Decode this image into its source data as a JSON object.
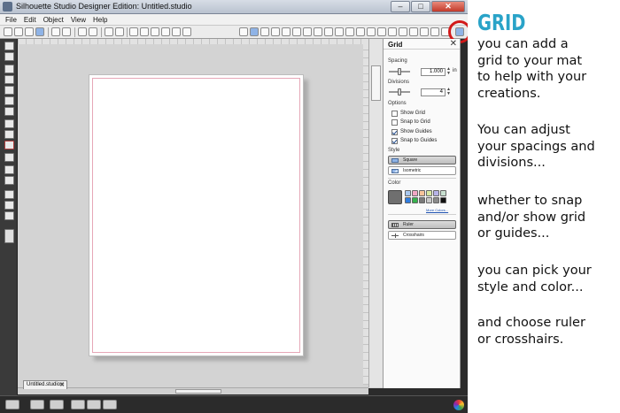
{
  "window": {
    "title": "Silhouette Studio Designer Edition: Untitled.studio",
    "min": "–",
    "max": "□",
    "close": "✕"
  },
  "menu": [
    "File",
    "Edit",
    "Object",
    "View",
    "Help"
  ],
  "document_tab": {
    "label": "Untitled.studio",
    "close": "✖"
  },
  "grid_panel": {
    "title": "Grid",
    "close": "✕",
    "spacing_label": "Spacing",
    "spacing_value": "1.000",
    "spacing_unit": "in",
    "spacing_slider_fraction": 0.5,
    "divisions_label": "Divisions",
    "divisions_value": "4",
    "divisions_slider_fraction": 0.5,
    "spin_up": "▲",
    "spin_down": "▼",
    "options_label": "Options",
    "options": [
      {
        "label": "Show Grid",
        "checked": false
      },
      {
        "label": "Snap to Grid",
        "checked": false
      },
      {
        "label": "Show Guides",
        "checked": true
      },
      {
        "label": "Snap to Guides",
        "checked": true
      }
    ],
    "style_label": "Style",
    "styles": [
      {
        "label": "Square",
        "selected": true
      },
      {
        "label": "Isometric",
        "selected": false
      }
    ],
    "color_label": "Color",
    "current_color": "#6f6f6f",
    "swatches": [
      "#a9c8ef",
      "#f2a6c4",
      "#f7c39a",
      "#d8e8a0",
      "#b7b3e8",
      "#c8e0d0",
      "#2f7de0",
      "#37b24d",
      "#7a7a7a",
      "#c9c9c9",
      "#8a8a8a",
      "#111111"
    ],
    "more_colors": "More Colors...",
    "cursor_styles": [
      {
        "label": "Ruler",
        "selected": true
      },
      {
        "label": "Crosshairs",
        "selected": false
      }
    ]
  },
  "tutorial": {
    "heading": "GRID",
    "heading_color": "#29a3c8",
    "paragraphs": [
      "you can add a\ngrid to your mat\nto help with your\ncreations.",
      "You can adjust\nyour spacings and\ndivisions...",
      "whether to snap\nand/or show grid\nor guides...",
      "you can pick your\nstyle and color...",
      "and choose ruler\nor crosshairs."
    ]
  },
  "highlight_color": "#d21919"
}
